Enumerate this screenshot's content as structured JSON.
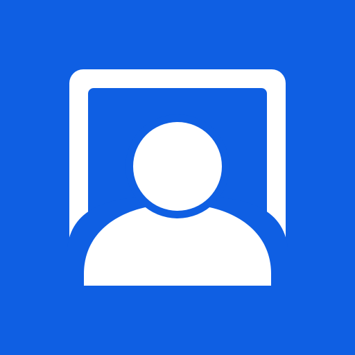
{
  "icon": {
    "name": "user-profile-frame-icon",
    "colors": {
      "background": "#0F5FE3",
      "foreground": "#FFFFFF"
    }
  }
}
